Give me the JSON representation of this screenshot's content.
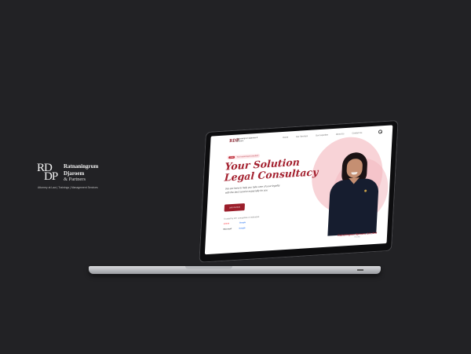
{
  "brand": {
    "monogram_line1": "RD",
    "monogram_line2": "DP",
    "name_line1": "Ratnaningrum",
    "name_line2": "Djaroem",
    "name_line3": "& Partners",
    "tagline": "Attorney at Law | Trainings | Management Services"
  },
  "website": {
    "nav": {
      "logo_mark": "RDP",
      "logo_text": "Ratnaningrum Djaroem & Partners",
      "links": [
        "Home",
        "Our Services",
        "Our Expertise",
        "About Us",
        "Contact Us"
      ]
    },
    "hero": {
      "badge_pill": "New",
      "badge_text": "Your trusted legal consultant",
      "title_line1": "Your Solution",
      "title_line2": "Legal Consultacy",
      "description": "We are here to help you take care of your legality with the best service especially for you",
      "cta_label": "Let's Consult",
      "trust_text": "Trusted by 20+ companies in Indonesia",
      "logos": [
        "airbnb",
        "Google",
        "Microsoft",
        "Google"
      ],
      "person_name": "Ratnaningrum Djaroem, S.H, M.H",
      "person_role": "Founder"
    }
  },
  "colors": {
    "background": "#222225",
    "accent": "#a3202e",
    "hero_blob": "#f8d3d7"
  }
}
